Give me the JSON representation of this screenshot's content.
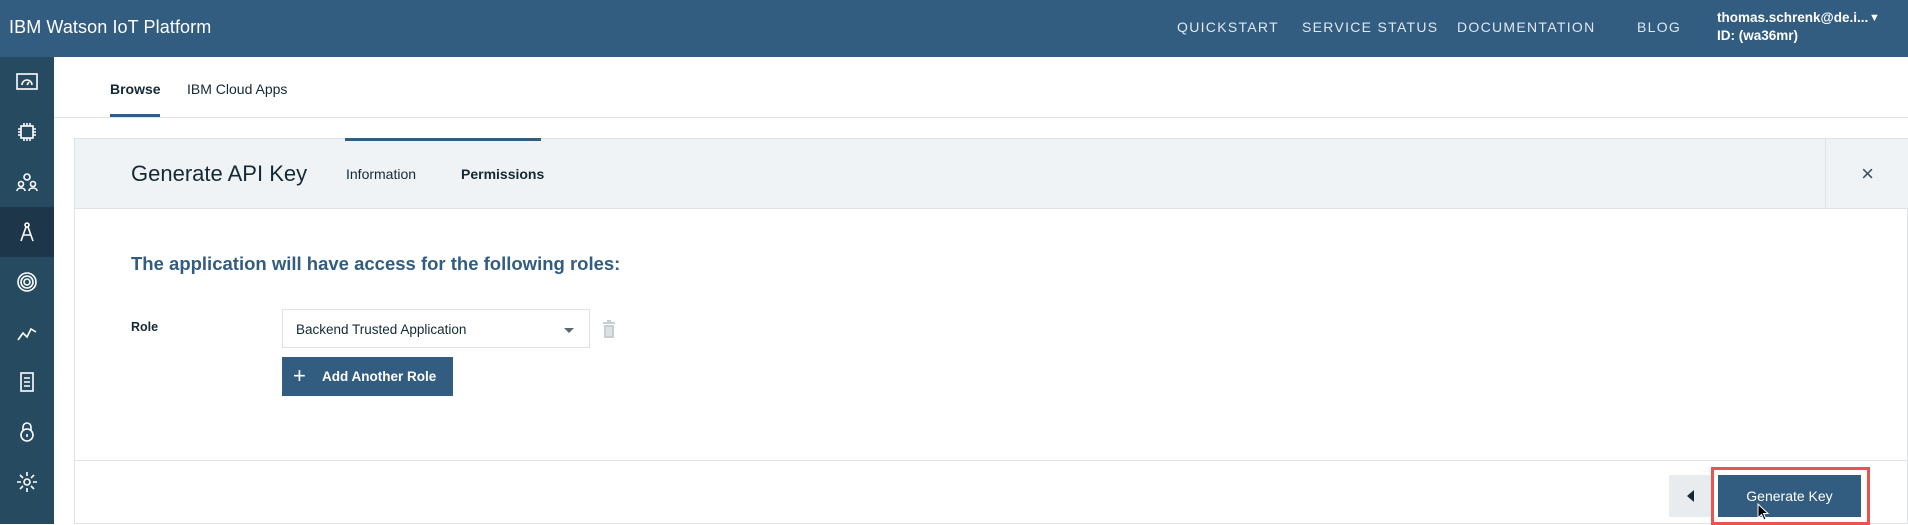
{
  "header": {
    "brand": "IBM Watson IoT Platform",
    "nav": [
      "QUICKSTART",
      "SERVICE STATUS",
      "DOCUMENTATION",
      "BLOG"
    ],
    "user_email": "thomas.schrenk@de.i...",
    "user_id": "ID: (wa36mr)"
  },
  "rail": {
    "icons": [
      "dashboard-icon",
      "devices-icon",
      "members-icon",
      "apps-icon",
      "rules-icon",
      "usage-icon",
      "extensions-icon",
      "security-icon",
      "settings-icon"
    ],
    "active_index": 3
  },
  "subtabs": {
    "items": [
      "Browse",
      "IBM Cloud Apps"
    ],
    "active_index": 0
  },
  "dialog": {
    "title": "Generate API Key",
    "steps": [
      "Information",
      "Permissions"
    ],
    "active_step": 1,
    "close_label": "×",
    "heading": "The application will have access for the following roles:",
    "role_label": "Role",
    "role_value": "Backend Trusted Application",
    "add_role_label": "Add Another Role",
    "add_role_icon": "+",
    "generate_label": "Generate Key"
  },
  "colors": {
    "header": "#325c80",
    "rail": "#264a60",
    "accent": "#325c80",
    "highlight": "#e8564b"
  }
}
